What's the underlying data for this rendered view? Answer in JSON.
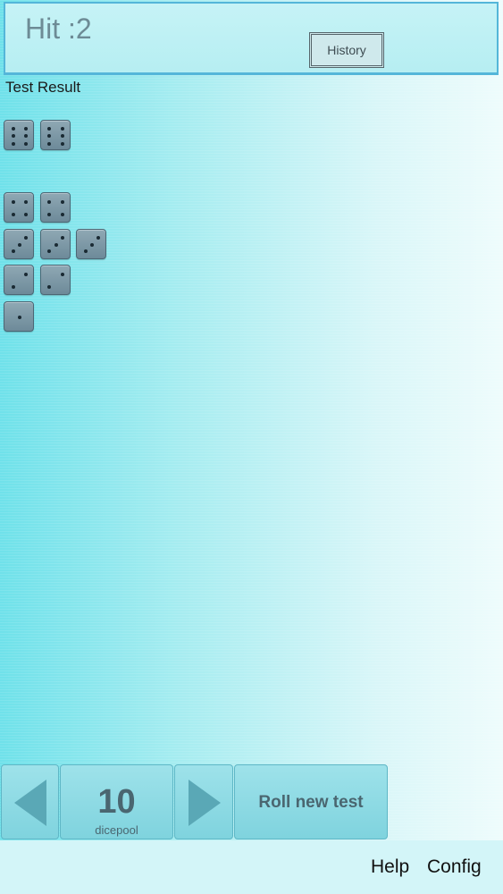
{
  "header": {
    "hit_text": "Hit :2",
    "history_label": "History"
  },
  "result": {
    "title": "Test Result",
    "rows": [
      [
        6,
        6
      ],
      [],
      [
        4,
        4
      ],
      [
        3,
        3,
        3
      ],
      [
        2,
        2
      ],
      [
        1
      ]
    ]
  },
  "controls": {
    "decrease_icon": "triangle-left-icon",
    "increase_icon": "triangle-right-icon",
    "dicepool_value": "10",
    "dicepool_label": "dicepool",
    "roll_label": "Roll new test"
  },
  "footer": {
    "help_label": "Help",
    "config_label": "Config"
  }
}
